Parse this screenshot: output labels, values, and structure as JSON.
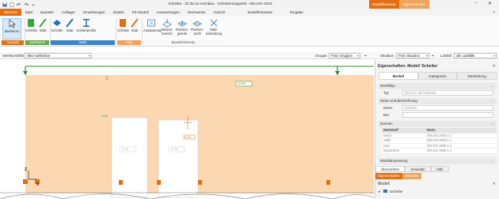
{
  "titlebar": {
    "title": "Scheibe - 32.08.11 Hochbau - Scheibentragwerk - MicroFe 2023",
    "ctx_tab_1": "Modellhinweise",
    "ctx_tab_2": "Eigenschaften",
    "minimize": "–",
    "close": "✕"
  },
  "tabs": [
    {
      "label": "MicroFe",
      "active": true
    },
    {
      "label": "Start"
    },
    {
      "label": "Bauteile"
    },
    {
      "label": "Auflager"
    },
    {
      "label": "Einwirkungen"
    },
    {
      "label": "Details"
    },
    {
      "label": "FE-Modell"
    },
    {
      "label": "Auswertungen"
    },
    {
      "label": "Nachweise"
    },
    {
      "label": "Ansicht"
    },
    {
      "label": "Modellhinweise"
    },
    {
      "label": "Eingabe"
    }
  ],
  "ribbon": {
    "markieren": "Markieren",
    "scheibe1": "Scheibe",
    "stab1": "Stab",
    "scheibe2": "Scheibe",
    "stab2": "Stab",
    "sonderprofile": "Sonderprofile",
    "scheibe3": "Scheibe",
    "stab3": "Stab",
    "aussparung": "Aussparung",
    "stuetzenbereich": "Stützen-bereich",
    "flaechengelenk": "Flächen-gelenk",
    "flaechenprofil": "Flächen-profil",
    "stabeinbindung": "Stab-einbindung",
    "group_auswahl": "Auswahl",
    "group_stahlbeton": "Stahlbeton",
    "group_stahl": "Stahl",
    "group_holz": "Holz",
    "group_bauteilelemente": "Bauteilelemente"
  },
  "filterbar": {
    "auswahlfilter_label": "Selektionsfilter",
    "auswahlfilter_value": "Alles markierbar",
    "gruppe_label": "Gruppe",
    "gruppe_value": "Freie Gruppen",
    "situation_label": "Situation",
    "situation_value": "Freie Situation",
    "lastfall_label": "Lastfall",
    "lastfall_value": "alle Lastfälle"
  },
  "canvas": {
    "dim_top": "10.00",
    "dim_door1": "0.20",
    "dim_door2": "1.00",
    "dim_w1": "0.74",
    "dim_w2": "0.74",
    "axis_z": "Z",
    "axis_x": "X"
  },
  "panel": {
    "title": "Eigenschaften: Modell 'Scheibe'",
    "close": "✕",
    "tab_modell": "Modell",
    "tab_kategorien": "Kategorien",
    "tab_darstellung": "Darstellung",
    "sec_modelltyp": "Modelltyp",
    "typ_label": "Typ",
    "typ_value": "MicroFe 2D Faltwerk",
    "sec_name": "Name und Bezeichnung",
    "name_label": "Name",
    "name_value": "Scheibe",
    "bez_label": "Bez.",
    "bez_value": "",
    "sec_normen": "Normen",
    "th_werkstoff": "Werkstoff",
    "th_norm": "Norm",
    "rows": [
      {
        "w": "Beton",
        "n": "DIN EN 1992-1-1"
      },
      {
        "w": "Stahl",
        "n": "DIN EN 1993-1-1"
      },
      {
        "w": "Holz",
        "n": "DIN EN 1995-1-1"
      },
      {
        "w": "Mauerwerk",
        "n": "DIN EN 1996-1-1"
      }
    ],
    "sec_modellanpassung": "Modellanpassung",
    "btab_uebersicht": "Übersichten",
    "btab_verwalter": "Verwalter",
    "btab_hilfe": "Hilfe",
    "b2_eigenschaften": "Eigenschaften",
    "b2_hinweise": "Hinweise",
    "modell_head": "Modell",
    "tree_item": "Scheibe"
  },
  "colors": {
    "accent": "#e56e10",
    "wall": "#fbd8b2",
    "support_green": "#2e8b2e",
    "selection_blue": "#d7e8f8"
  }
}
